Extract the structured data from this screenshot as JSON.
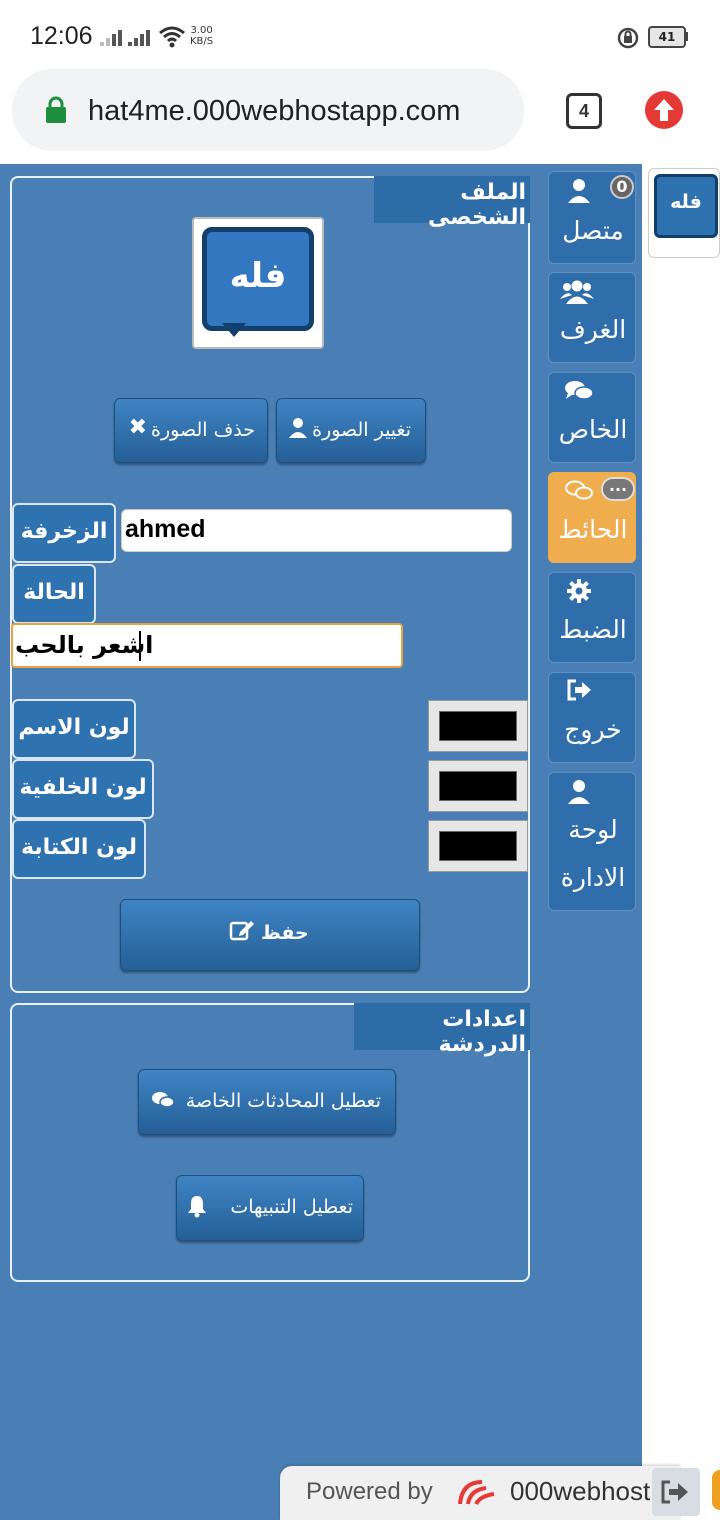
{
  "status_bar": {
    "time": "12:06",
    "net_speed_value": "3.00",
    "net_speed_unit": "KB/S",
    "battery": "41"
  },
  "browser": {
    "url": "hat4me.000webhostapp.com",
    "tab_count": "4"
  },
  "logo": {
    "text": "فله"
  },
  "profile": {
    "title": "الملف الشخصى",
    "change_photo": "تغيير الصورة",
    "delete_photo": "حذف الصورة",
    "decoration_label": "الزخرفة",
    "name_value": "ahmed",
    "status_label": "الحالة",
    "status_value": "اشعر بالحب",
    "name_color_label": "لون الاسم",
    "bg_color_label": "لون الخلفية",
    "text_color_label": "لون الكتابة",
    "save_label": "حفظ",
    "swatch_color": "#000000"
  },
  "chat_settings": {
    "title": "اعدادات الدردشة",
    "disable_private": "تعطيل المحادثات الخاصة",
    "disable_notifications": "تعطيل التنبيهات"
  },
  "nav": {
    "online": "متصل",
    "online_count": "0",
    "rooms": "الغرف",
    "private": "الخاص",
    "wall": "الحائط",
    "wall_badge": "...",
    "settings": "الضبط",
    "exit": "خروج",
    "admin_line1": "لوحة",
    "admin_line2": "الادارة"
  },
  "footer": {
    "powered_by": "Powered by",
    "brand": "000webhost"
  },
  "colors": {
    "page_bg": "#4a7fb5",
    "nav_bg": "#2f6eab",
    "wall_active": "#f0ad4e",
    "title_bg": "#2d6ca6"
  }
}
